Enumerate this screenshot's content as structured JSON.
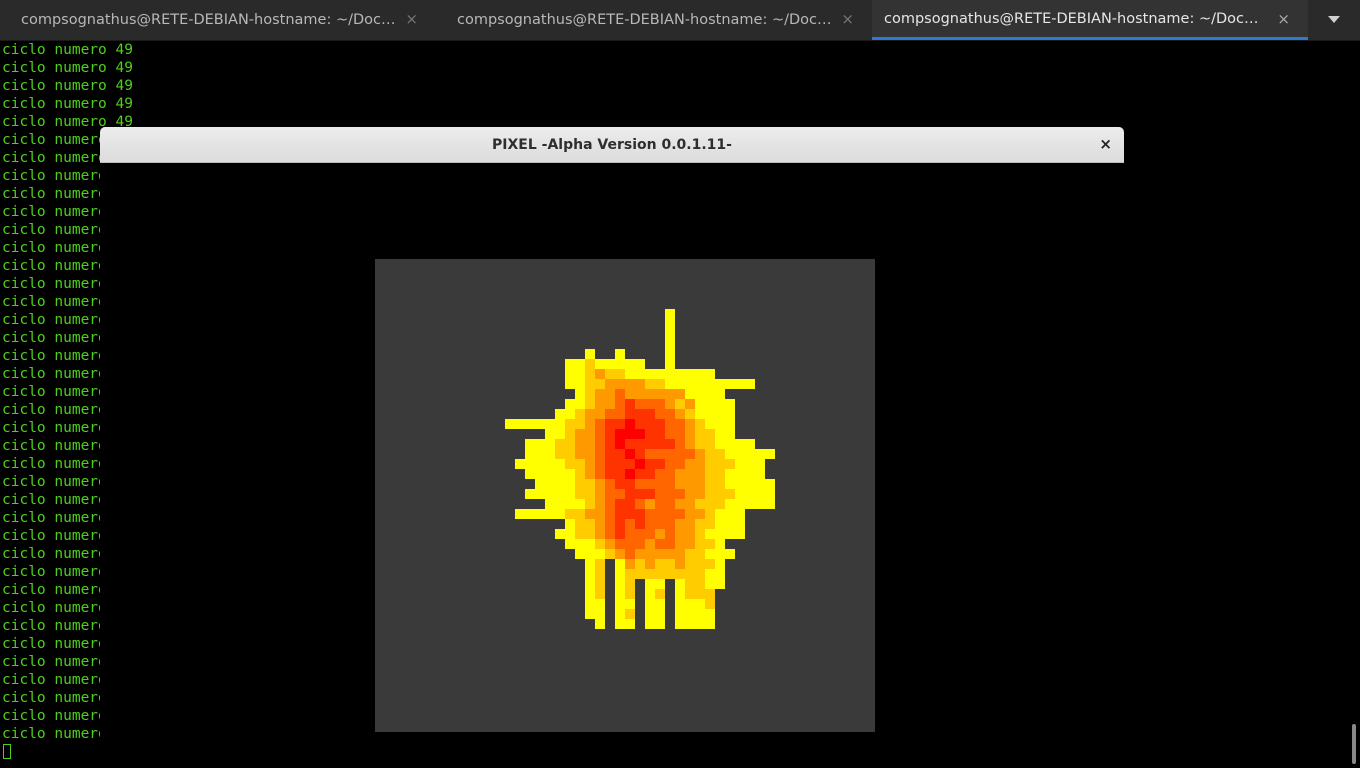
{
  "tabs": [
    {
      "title": "compsognathus@RETE-DEBIAN-hostname: ~/Documents/pixel",
      "active": false,
      "close": "×"
    },
    {
      "title": "compsognathus@RETE-DEBIAN-hostname: ~/Documents/pixel",
      "active": false,
      "close": "×"
    },
    {
      "title": "compsognathus@RETE-DEBIAN-hostname: ~/Documents/pixel",
      "active": true,
      "close": "×"
    }
  ],
  "tab_menu_icon": "chevron-down-icon",
  "terminal": {
    "line_text": "ciclo numero 49",
    "line_count": 39,
    "text_color": "#4fcf1c"
  },
  "pixel_window": {
    "title": "PIXEL -Alpha Version 0.0.1.11-",
    "close": "×",
    "canvas_bg": "#3a3a3a",
    "palette": {
      "1": "#ffff00",
      "2": "#ffcc00",
      "3": "#ff9900",
      "4": "#ff6600",
      "5": "#ff3300",
      "6": "#ff0000"
    },
    "grid": [
      "...............................",
      "...............................",
      "...............................",
      "...............................",
      "...............................",
      "..................1............",
      "..................1............",
      "..................1............",
      "..................1............",
      "..........1..1....1............",
      "........11211111..1............",
      "........112322111111111........",
      "........1122333322111111111....",
      ".........123343333331111.......",
      "........11233454443231111......",
      ".......112334455544321111......",
      "..11111122345565554432111......",
      "......1123345666554432211......",
      "....11122334565555543221111....",
      "....1112233455654444432211111..",
      "...1111122345556554433222111...",
      "....111112345565544333221111...",
      ".....111122345544443332211111..",
      "....1111122344555444332221111..",
      "......11112345543443322211111..",
      "...11111223345554444332111.....",
      "........122345454443322111.....",
      ".......1122345444343321111.....",
      "........1112344434433221.......",
      ".........1112343333322111......",
      "..........12.13232232221.......",
      "..........12.12222222211.......",
      "..........12.12.11.12211.......",
      "..........12.12.12.1222........",
      "..........11.11.11.1112........",
      "..........11.12.11.1111........",
      "...........1.11.11.1111........",
      "...........................",
      "..............................."
    ]
  }
}
